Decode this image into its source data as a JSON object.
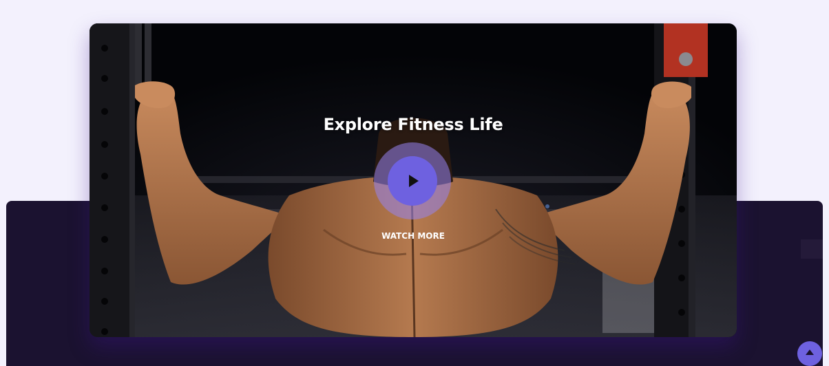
{
  "video": {
    "title": "Explore Fitness Life",
    "cta_label": "WATCH MORE",
    "play_icon": "play-icon",
    "background_image": "athlete-pull-up-gym-photo"
  },
  "scroll_top": {
    "icon": "arrow-up-icon"
  },
  "colors": {
    "accent": "#6e61e0",
    "accent_halo": "#9684f0",
    "page_background": "#f3f1fd",
    "dark_band": "#1b1230",
    "text_light": "#ffffff"
  }
}
